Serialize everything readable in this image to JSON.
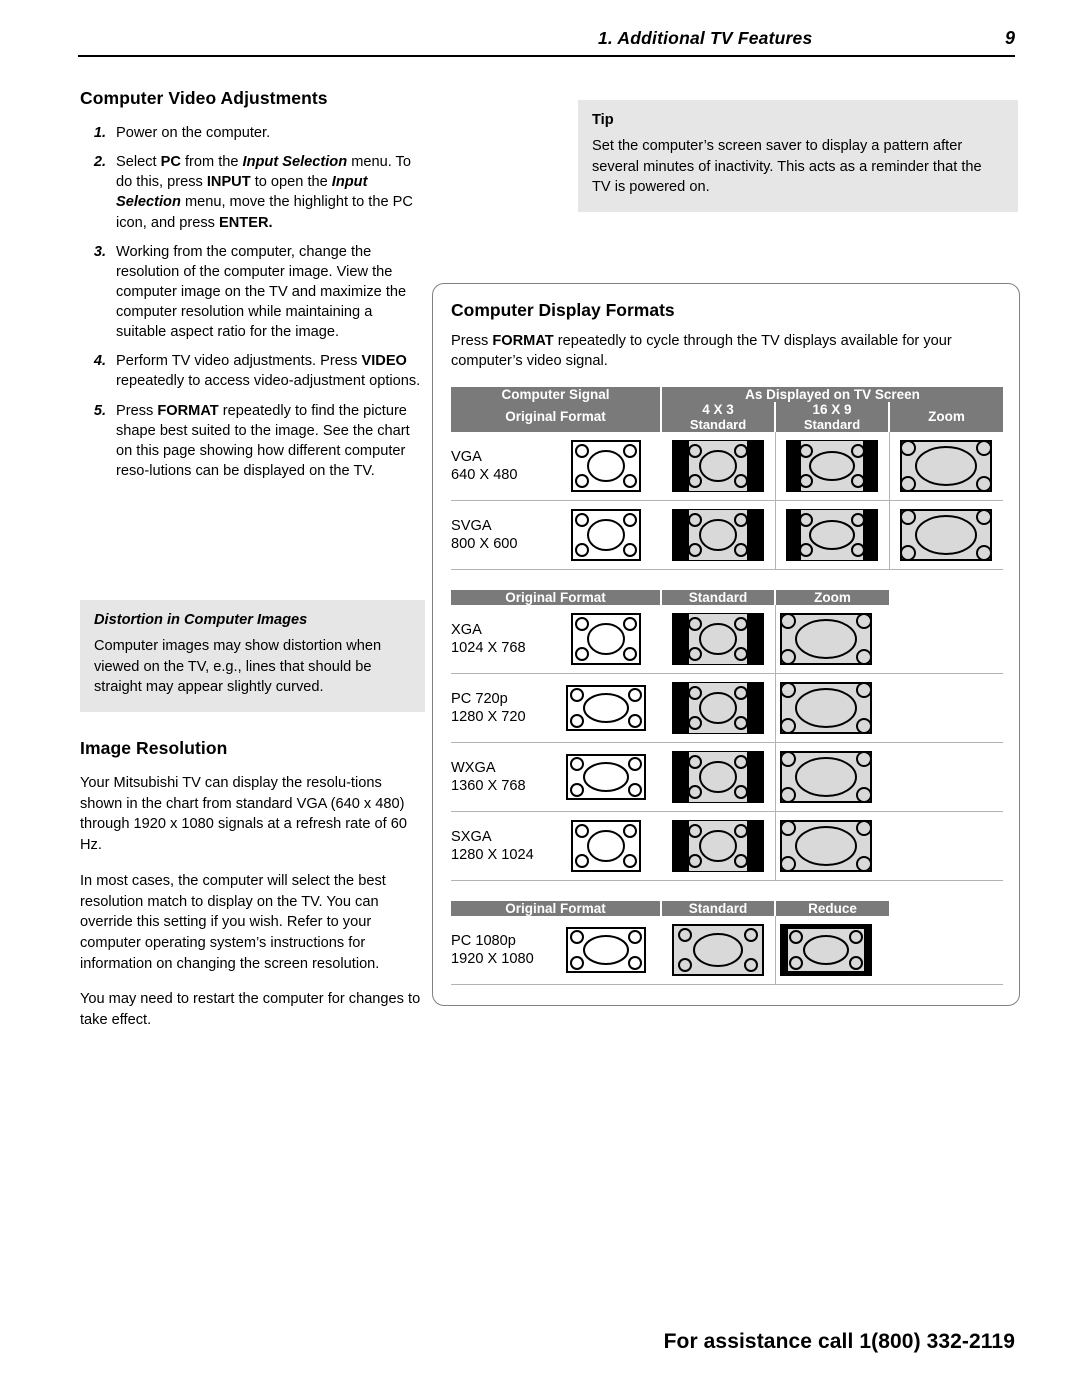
{
  "header": {
    "chapter": "1.  Additional TV Features",
    "page_number": "9"
  },
  "footer": {
    "text": "For assistance call 1(800) 332-2119"
  },
  "left": {
    "section_title": "Computer Video Adjustments",
    "steps": [
      {
        "num": "1.",
        "html": "Power on the computer."
      },
      {
        "num": "2.",
        "html": "Select <span class=\"b\">PC</span> from the <span class=\"bi\">Input Selection</span> menu.  To do this, press <span class=\"b\">INPUT</span> to open the <span class=\"bi\">Input Selection</span> menu, move the highlight to the PC icon, and press <span class=\"b\">ENTER.</span>"
      },
      {
        "num": "3.",
        "html": "Working from the computer, change the resolution of the computer image.  View the computer image on the TV and maximize the computer resolution while maintaining a suitable aspect ratio for the image."
      },
      {
        "num": "4.",
        "html": "Perform TV video adjustments.  Press <span class=\"b\">VIDEO</span> repeatedly to access video-adjustment options."
      },
      {
        "num": "5.",
        "html": "Press <span class=\"b\">FORMAT</span> repeatedly to find the picture shape best suited to the image.  See the chart on this page showing how different computer reso-lutions can be displayed on the TV."
      }
    ],
    "distortion_box": {
      "title": "Distortion in Computer Images",
      "body": "Computer images may show distortion when viewed on the TV, e.g., lines that should be straight may appear slightly curved."
    },
    "image_resolution": {
      "title": "Image Resolution",
      "paragraphs": [
        "Your Mitsubishi TV can display the resolu-tions shown in the chart from standard VGA (640 x 480) through 1920 x 1080 signals at a refresh rate of 60 Hz.",
        "In most cases, the computer will select the best resolution match to display on the TV.  You can override this setting if you wish.  Refer to your computer operating system’s instructions for information on changing the screen resolution.",
        "You may need to restart the computer for changes to take effect."
      ]
    }
  },
  "tip": {
    "title": "Tip",
    "body": "Set the computer’s screen saver to display a pattern after several minutes of inactivity.  This acts as a reminder that the TV is powered on."
  },
  "formats": {
    "title": "Computer Display Formats",
    "lead_html": "Press <span class=\"b\">FORMAT</span> repeatedly to cycle through the TV displays available for your computer’s video signal.",
    "table1": {
      "header_top": {
        "left": "Computer Signal",
        "right": "As Displayed on TV Screen"
      },
      "header_row": [
        {
          "label": "Original Format"
        },
        {
          "label": "4 X 3",
          "sub": "Standard"
        },
        {
          "label": "16 X 9",
          "sub": "Standard"
        },
        {
          "label": "Zoom"
        }
      ],
      "rows": [
        {
          "name": "VGA",
          "res": "640 X 480"
        },
        {
          "name": "SVGA",
          "res": "800 X 600"
        }
      ]
    },
    "table2": {
      "header_row": [
        "Original Format",
        "Standard",
        "Zoom"
      ],
      "rows": [
        {
          "name": "XGA",
          "res": "1024 X 768"
        },
        {
          "name": "PC 720p",
          "res": "1280 X 720"
        },
        {
          "name": "WXGA",
          "res": "1360 X 768"
        },
        {
          "name": "SXGA",
          "res": "1280 X 1024"
        }
      ]
    },
    "table3": {
      "header_row": [
        "Original Format",
        "Standard",
        "Reduce"
      ],
      "rows": [
        {
          "name": "PC 1080p",
          "res": "1920 X 1080"
        }
      ]
    }
  },
  "colors": {
    "header_gray": "#7a7a7a",
    "box_gray": "#e6e6e6",
    "rule": "#b3b3b3",
    "screen_fill": "#d9d9d9",
    "screen_dark": "#000000"
  }
}
